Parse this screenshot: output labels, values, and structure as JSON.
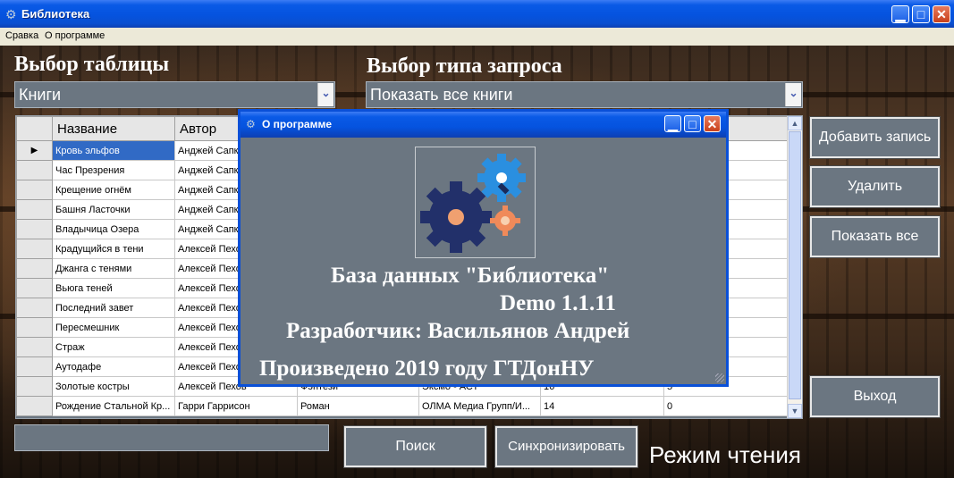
{
  "window": {
    "title": "Библиотека"
  },
  "menu": {
    "items": [
      "Сравка",
      "О программе"
    ]
  },
  "selectors": {
    "table_label": "Выбор таблицы",
    "table_value": "Книги",
    "query_label": "Выбор типа запроса",
    "query_value": "Показать все книги"
  },
  "grid": {
    "columns": [
      "Название",
      "Автор",
      "",
      "",
      "",
      ""
    ],
    "rows": [
      {
        "title": "Кровь эльфов",
        "author": "Анджей Сапк",
        "genre": "",
        "publisher": "",
        "n1": "",
        "n2": ""
      },
      {
        "title": "Час Презрения",
        "author": "Анджей Сапк",
        "genre": "",
        "publisher": "",
        "n1": "",
        "n2": ""
      },
      {
        "title": "Крещение огнём",
        "author": "Анджей Сапк",
        "genre": "",
        "publisher": "",
        "n1": "",
        "n2": ""
      },
      {
        "title": "Башня Ласточки",
        "author": "Анджей Сапк",
        "genre": "",
        "publisher": "",
        "n1": "",
        "n2": ""
      },
      {
        "title": "Владычица Озера",
        "author": "Анджей Сапк",
        "genre": "",
        "publisher": "",
        "n1": "",
        "n2": ""
      },
      {
        "title": "Крадущийся в тени",
        "author": "Алексей Пехо",
        "genre": "",
        "publisher": "",
        "n1": "",
        "n2": ""
      },
      {
        "title": "Джанга с тенями",
        "author": "Алексей Пехо",
        "genre": "",
        "publisher": "",
        "n1": "",
        "n2": ""
      },
      {
        "title": "Вьюга теней",
        "author": "Алексей Пехо",
        "genre": "",
        "publisher": "",
        "n1": "",
        "n2": ""
      },
      {
        "title": "Последний завет",
        "author": "Алексей Пехо",
        "genre": "",
        "publisher": "",
        "n1": "",
        "n2": ""
      },
      {
        "title": "Пересмешник",
        "author": "Алексей Пехо",
        "genre": "",
        "publisher": "",
        "n1": "",
        "n2": ""
      },
      {
        "title": "Страж",
        "author": "Алексей Пехо",
        "genre": "",
        "publisher": "",
        "n1": "",
        "n2": ""
      },
      {
        "title": "Аутодафе",
        "author": "Алексей Пехо",
        "genre": "",
        "publisher": "",
        "n1": "",
        "n2": ""
      },
      {
        "title": "Золотые костры",
        "author": "Алексей Пехов",
        "genre": "Фэнтези",
        "publisher": "Эксмо - АСТ",
        "n1": "16",
        "n2": "5"
      },
      {
        "title": "Рождение Стальной Кр...",
        "author": "Гарри Гаррисон",
        "genre": "Роман",
        "publisher": "ОЛМА Медиа Групп/И...",
        "n1": "14",
        "n2": "0"
      }
    ],
    "selected_row_marker": "▶"
  },
  "buttons": {
    "add": "Добавить запись",
    "delete": "Удалить",
    "show_all": "Показать все",
    "exit": "Выход",
    "search": "Поиск",
    "sync": "Синхронизировать"
  },
  "search_input": {
    "value": ""
  },
  "mode": "Режим чтения",
  "dialog": {
    "title": "О программе",
    "line1": "База данных \"Библиотека\"",
    "line2": "Demo 1.1.11",
    "line3": "Разработчик: Васильянов Андрей",
    "line4": "Произведено 2019 году ГТДонНУ"
  },
  "icons": {
    "app": "gear-icon",
    "minimize": "minimize-icon",
    "maximize": "maximize-icon",
    "close": "close-icon",
    "dropdown": "chevron-down-icon"
  },
  "colors": {
    "titlebar": "#0553df",
    "panel": "#6b7681",
    "selection": "#316ac5"
  }
}
